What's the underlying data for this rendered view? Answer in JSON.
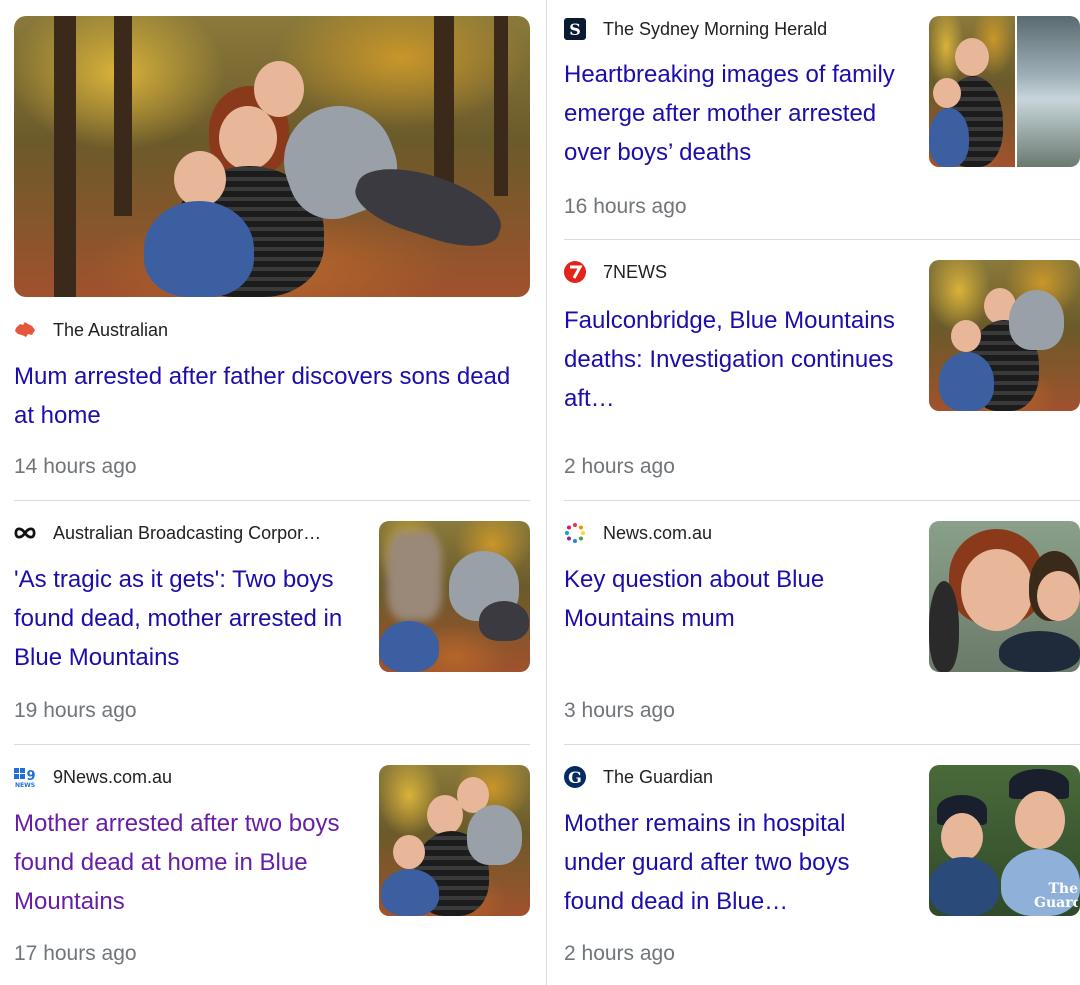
{
  "articles": [
    {
      "source": "The Australian",
      "headline": "Mum arrested after father discovers sons dead at home",
      "time": "14 hours ago",
      "favicon": "australia-map-icon",
      "visited": false
    },
    {
      "source": "The Sydney Morning Herald",
      "headline": "Heartbreaking images of family emerge after mother arrested over boys’ deaths",
      "time": "16 hours ago",
      "favicon": "smh-s-icon",
      "visited": false
    },
    {
      "source": "7NEWS",
      "headline": "Faulconbridge, Blue Mountains deaths: Investigation continues aft…",
      "time": "2 hours ago",
      "favicon": "seven-icon",
      "visited": false
    },
    {
      "source": "Australian Broadcasting Corpor…",
      "headline": "'As tragic as it gets': Two boys found dead, mother arrested in Blue Mountains",
      "time": "19 hours ago",
      "favicon": "abc-lissajous-icon",
      "visited": false
    },
    {
      "source": "News.com.au",
      "headline": "Key question about Blue Mountains mum",
      "time": "3 hours ago",
      "favicon": "dots-ring-icon",
      "visited": false
    },
    {
      "source": "9News.com.au",
      "headline": "Mother arrested after two boys found dead at home in Blue Mountains",
      "time": "17 hours ago",
      "favicon": "nine-news-icon",
      "visited": true
    },
    {
      "source": "The Guardian",
      "headline": "Mother remains in hospital under guard after two boys found dead in Blue…",
      "time": "2 hours ago",
      "favicon": "guardian-g-icon",
      "visited": false
    }
  ],
  "colors": {
    "link": "#1a0dab",
    "visited": "#681da8",
    "meta": "#70757a",
    "divider": "#dadce0"
  },
  "thumb_text": {
    "guardian_watermark": "The Guard"
  }
}
